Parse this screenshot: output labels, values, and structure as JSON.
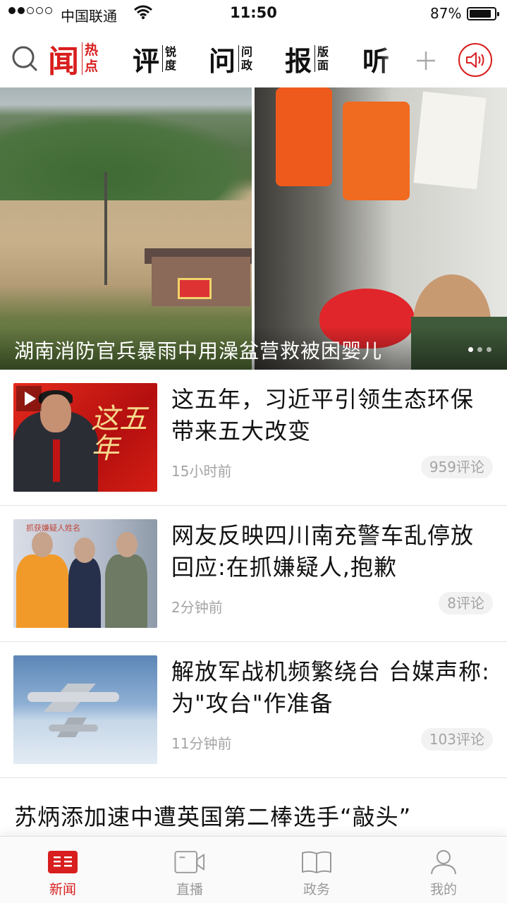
{
  "status_bar": {
    "carrier": "中国联通",
    "time": "11:50",
    "battery": "87%",
    "battery_level": 0.87
  },
  "top_nav": {
    "tabs": [
      {
        "big": "闻",
        "small_top": "热",
        "small_bottom": "点",
        "active": true
      },
      {
        "big": "评",
        "small_top": "锐",
        "small_bottom": "度",
        "active": false
      },
      {
        "big": "问",
        "small_top": "问",
        "small_bottom": "政",
        "active": false
      },
      {
        "big": "报",
        "small_top": "版",
        "small_bottom": "面",
        "active": false
      },
      {
        "big": "听",
        "small_top": "",
        "small_bottom": "",
        "active": false
      }
    ],
    "accent_color": "#d81e1e"
  },
  "hero": {
    "caption": "湖南消防官兵暴雨中用澡盆营救被困婴儿",
    "page_count": 3,
    "active_page": 1
  },
  "news": [
    {
      "title": "这五年，习近平引领生态环保带来五大改变",
      "time": "15小时前",
      "comments": "959评论",
      "thumb_calligraphy": "这五年",
      "is_video": true
    },
    {
      "title": "网友反映四川南充警车乱停放回应:在抓嫌疑人,抱歉",
      "time": "2分钟前",
      "comments": "8评论",
      "thumb_banner": "抓获嫌疑人姓名"
    },
    {
      "title": "解放军战机频繁绕台 台媒声称:为\"攻台\"作准备",
      "time": "11分钟前",
      "comments": "103评论"
    }
  ],
  "partial_headline": "苏炳添加速中遭英国第二棒选手“敲头”",
  "tab_bar": [
    {
      "label": "新闻",
      "icon": "news-icon",
      "active": true
    },
    {
      "label": "直播",
      "icon": "video-camera-icon",
      "active": false
    },
    {
      "label": "政务",
      "icon": "book-icon",
      "active": false
    },
    {
      "label": "我的",
      "icon": "user-icon",
      "active": false
    }
  ]
}
